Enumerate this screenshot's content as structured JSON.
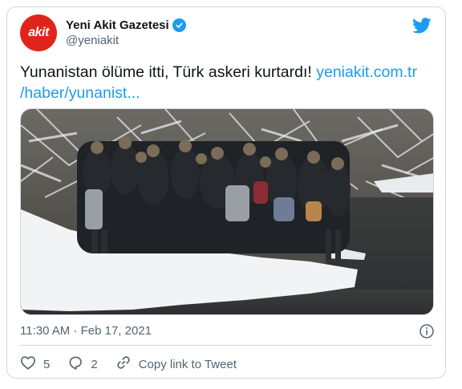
{
  "account": {
    "avatar_text": "akit",
    "display_name": "Yeni Akit Gazetesi",
    "handle": "@yeniakit"
  },
  "icons": {
    "brand": "twitter-bird-icon",
    "verified": "verified-badge-icon",
    "info": "info-icon",
    "like": "heart-icon",
    "reply": "reply-bubble-icon",
    "copy_link": "link-icon"
  },
  "tweet": {
    "text": "Yunanistan ölüme itti, Türk askeri kurtardı!",
    "link_line1": "yeniakit.com.tr",
    "link_line2": "/haber/yunanist...",
    "timestamp": "11:30 AM · Feb 17, 2021"
  },
  "actions": {
    "likes": "5",
    "replies": "2",
    "copy_link_label": "Copy link to Tweet"
  },
  "colors": {
    "accent": "#1d9bf0",
    "brand_red": "#e1241b",
    "text_secondary": "#536471",
    "border": "#cfd9de"
  }
}
